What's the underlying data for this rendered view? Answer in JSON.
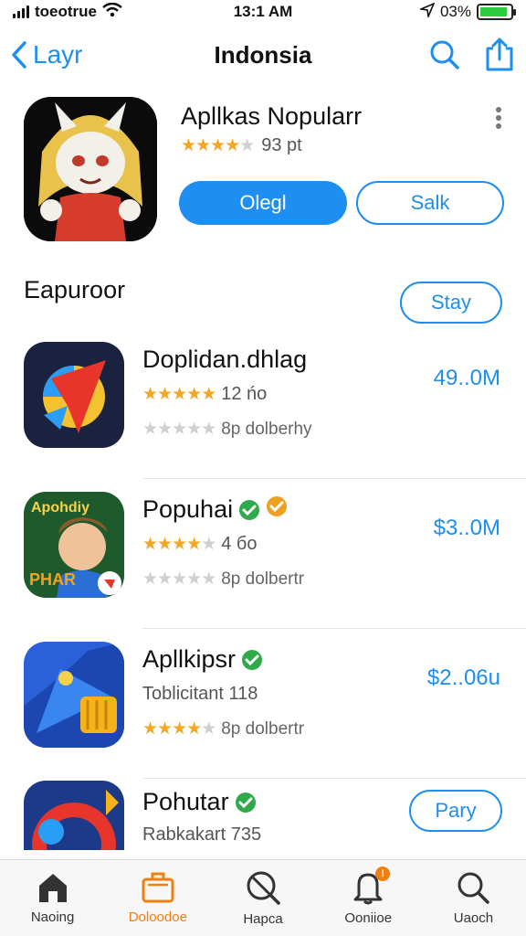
{
  "status_bar": {
    "carrier": "toeotrue",
    "time": "13:1 AM",
    "battery": "03%",
    "battery_level": 0.9
  },
  "nav": {
    "back_label": "Layr",
    "title": "Indonsia"
  },
  "featured": {
    "title": "Apllkas Nopularr",
    "stars": 4,
    "rating_text": "93 pt",
    "primary_label": "Olegl",
    "secondary_label": "Salk"
  },
  "section": {
    "title": "Eapuroor",
    "button_label": "Stay"
  },
  "apps": [
    {
      "name": "Doplidan.dhlag",
      "stars": 5,
      "sub_text": "12 ńo",
      "stars2": 0,
      "sub2_text": "8p dolberhy",
      "price": "49..0M"
    },
    {
      "name": "Popuhai",
      "verified": true,
      "stars": 4,
      "sub_text": "4 бo",
      "stars2": 0,
      "sub2_text": "8p dolbertr",
      "price": "$3..0M",
      "icon_text_top": "Apohdiy",
      "icon_text_bottom": "PHAR"
    },
    {
      "name": "Apllkipsr",
      "verified": true,
      "sub_text": "Toblicitant 118",
      "stars2": 4,
      "sub2_text": "8p dolbertr",
      "price": "$2..06u"
    },
    {
      "name": "Pohutar",
      "verified": true,
      "sub_text": "Rabkakart 735",
      "button_label": "Pary"
    }
  ],
  "tabs": [
    {
      "label": "Naoing",
      "icon": "home-icon"
    },
    {
      "label": "Doloodoe",
      "icon": "briefcase-icon",
      "active": true
    },
    {
      "label": "Hapca",
      "icon": "no-search-icon"
    },
    {
      "label": "Ooniioe",
      "icon": "bell-icon",
      "badge": "!"
    },
    {
      "label": "Uaoch",
      "icon": "search-icon"
    }
  ],
  "colors": {
    "accent": "#1e8ef0",
    "active_tab": "#f07f12",
    "star": "#f5a623",
    "verified": "#2eaa4a",
    "battery": "#2ecc40"
  }
}
